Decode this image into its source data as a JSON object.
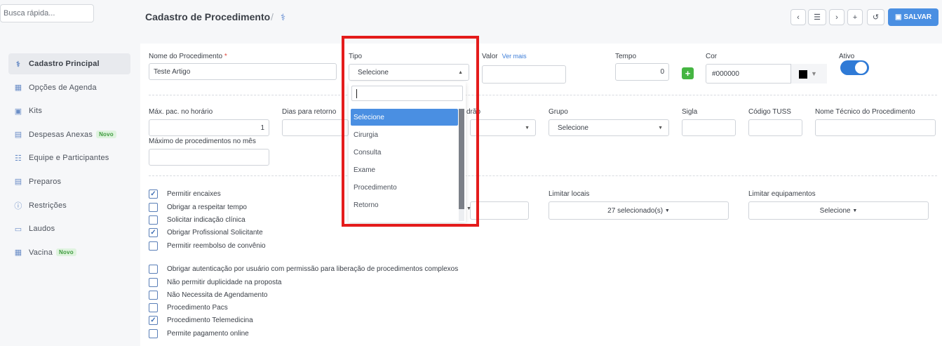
{
  "sidebar": {
    "search_placeholder": "Busca rápida...",
    "items": [
      {
        "label": "Cadastro Principal",
        "icon": "stethoscope-icon",
        "active": true
      },
      {
        "label": "Opções de Agenda",
        "icon": "calendar-icon"
      },
      {
        "label": "Kits",
        "icon": "briefcase-icon"
      },
      {
        "label": "Despesas Anexas",
        "icon": "card-icon",
        "badge": "Novo"
      },
      {
        "label": "Equipe e Participantes",
        "icon": "team-icon"
      },
      {
        "label": "Preparos",
        "icon": "list-icon"
      },
      {
        "label": "Restrições",
        "icon": "alert-icon"
      },
      {
        "label": "Laudos",
        "icon": "document-icon"
      },
      {
        "label": "Vacina",
        "icon": "calendar-icon",
        "badge": "Novo"
      }
    ]
  },
  "header": {
    "title": "Cadastro de Procedimento",
    "separator": "/",
    "save_label": "SALVAR"
  },
  "form": {
    "nome_label": "Nome do Procedimento",
    "nome_value": "Teste Artigo",
    "tipo_label": "Tipo",
    "tipo_value": "Selecione",
    "valor_label": "Valor",
    "ver_mais": "Ver mais",
    "tempo_label": "Tempo",
    "tempo_value": "0",
    "cor_label": "Cor",
    "cor_value": "#000000",
    "ativo_label": "Ativo",
    "max_pac_label": "Máx. pac. no horário",
    "max_pac_value": "1",
    "dias_retorno_label": "Dias para retorno",
    "padrao_label_fragment": "drão",
    "grupo_label": "Grupo",
    "grupo_value": "Selecione",
    "sigla_label": "Sigla",
    "tuss_label": "Código TUSS",
    "nome_tecnico_label": "Nome Técnico do Procedimento",
    "max_mes_label": "Máximo de procedimentos no mês",
    "limitar_locais_label": "Limitar locais",
    "limitar_locais_value": "27 selecionado(s)",
    "limitar_equip_label": "Limitar equipamentos",
    "limitar_equip_value": "Selecione"
  },
  "checkboxes": [
    {
      "label": "Permitir encaixes",
      "checked": true
    },
    {
      "label": "Obrigar a respeitar tempo",
      "checked": false
    },
    {
      "label": "Solicitar indicação clínica",
      "checked": false
    },
    {
      "label": "Obrigar Profissional Solicitante",
      "checked": true
    },
    {
      "label": "Permitir reembolso de convênio",
      "checked": false
    },
    {
      "label": "Obrigar autenticação por usuário com permissão para liberação de procedimentos complexos",
      "checked": false
    },
    {
      "label": "Não permitir duplicidade na proposta",
      "checked": false
    },
    {
      "label": "Não Necessita de Agendamento",
      "checked": false
    },
    {
      "label": "Procedimento Pacs",
      "checked": false
    },
    {
      "label": "Procedimento Telemedicina",
      "checked": true
    },
    {
      "label": "Permite pagamento online",
      "checked": false
    }
  ],
  "dropdown": {
    "options": [
      "Selecione",
      "Cirurgia",
      "Consulta",
      "Exame",
      "Procedimento",
      "Retorno"
    ],
    "highlighted": "Selecione"
  },
  "colors": {
    "accent": "#4a8fe2",
    "toggle_on": "#2f7ad6",
    "highlight_frame": "#e41b1b",
    "add_green": "#45b542"
  }
}
